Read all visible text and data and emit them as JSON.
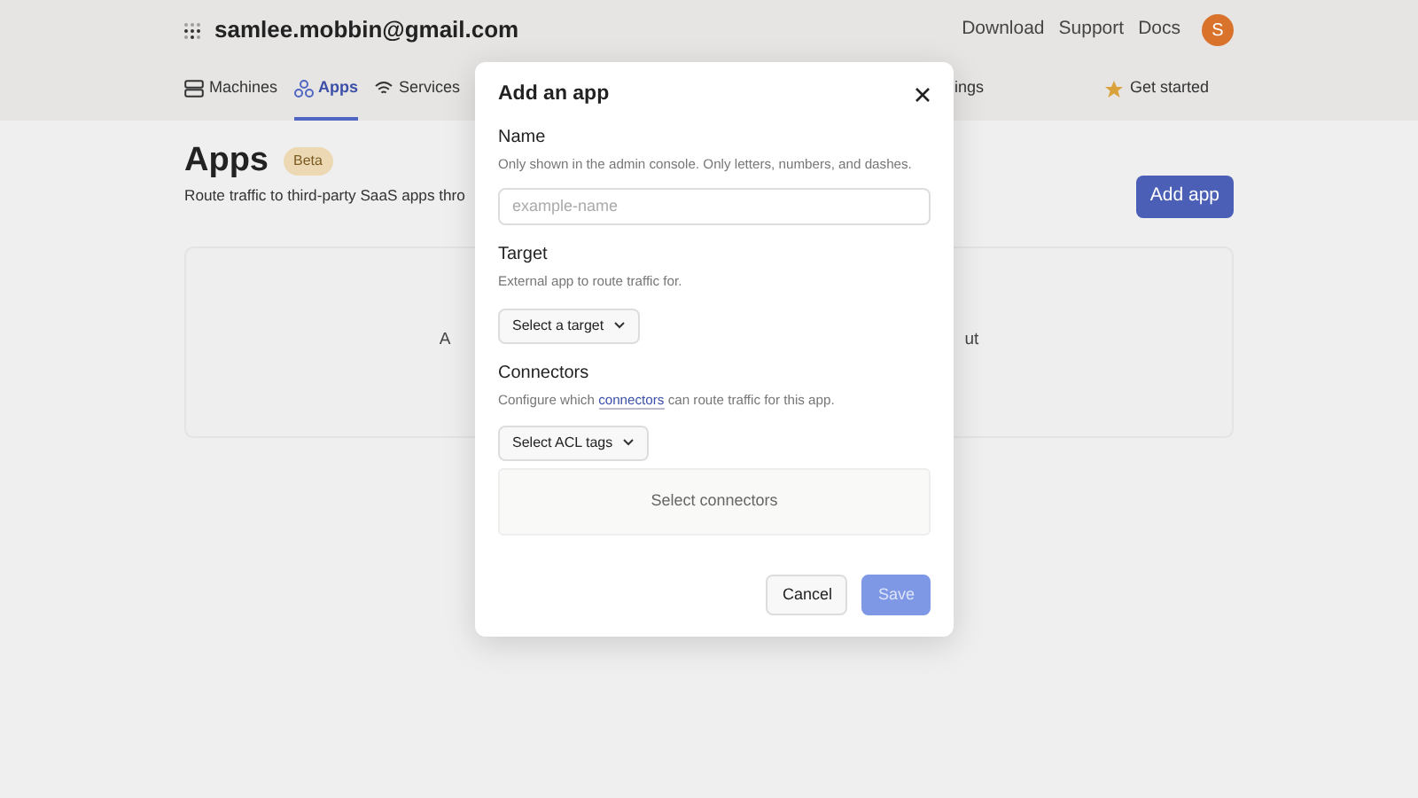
{
  "header": {
    "account": "samlee.mobbin@gmail.com",
    "links": [
      "Download",
      "Support",
      "Docs"
    ],
    "avatar": "S"
  },
  "nav": {
    "tabs": [
      {
        "label": "Machines",
        "selected": false
      },
      {
        "label": "Apps",
        "selected": true
      },
      {
        "label": "Services",
        "selected": false
      },
      {
        "label": "ings",
        "selected": false
      }
    ],
    "get_started": "Get started"
  },
  "page": {
    "title": "Apps",
    "badge": "Beta",
    "description": "Route traffic to third-party SaaS apps thro",
    "add_button": "Add app",
    "empty_state": [
      "A",
      "ut"
    ]
  },
  "dialog": {
    "title": "Add an app",
    "name": {
      "label": "Name",
      "help": "Only shown in the admin console. Only letters, numbers, and dashes.",
      "placeholder": "example-name"
    },
    "target": {
      "label": "Target",
      "help": "External app to route traffic for.",
      "dropdown": "Select a target"
    },
    "connectors": {
      "label": "Connectors",
      "help_before": "Configure which",
      "help_link": "connectors",
      "help_after": "can route traffic for this app.",
      "dropdown": "Select ACL tags",
      "panel": "Select connectors"
    },
    "buttons": [
      {
        "label": "Cancel",
        "kind": "secondary",
        "disabled": false
      },
      {
        "label": "Save",
        "kind": "primary",
        "disabled": true
      }
    ]
  }
}
